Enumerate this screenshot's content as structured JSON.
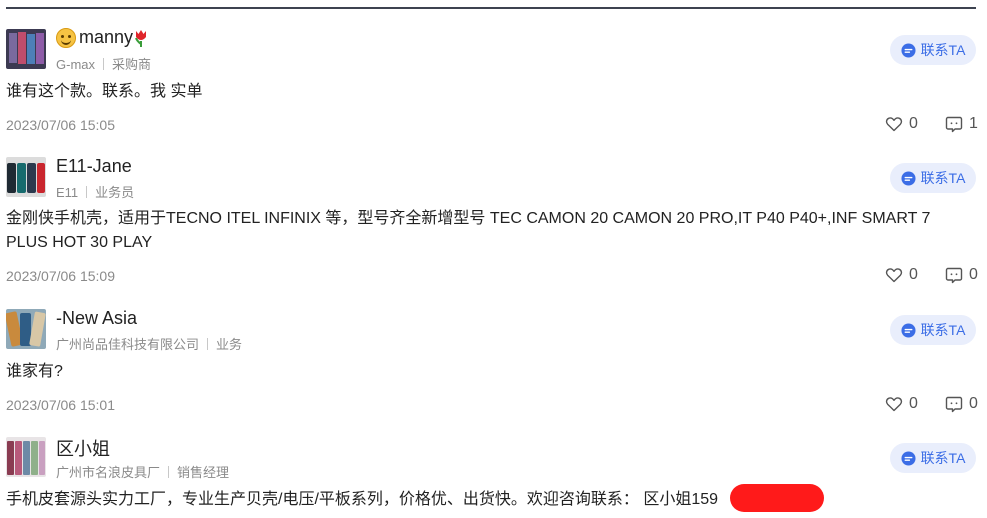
{
  "posts": [
    {
      "username": "manny",
      "company": "G-max",
      "role": "采购商",
      "contact_label": "联系TA",
      "content": "谁有这个款。联系。我 实单",
      "timestamp": "2023/07/06 15:05",
      "likes": "0",
      "comments": "1"
    },
    {
      "username": "E11-Jane",
      "company": "E11",
      "role": "业务员",
      "contact_label": "联系TA",
      "content": "金刚侠手机壳，适用于TECNO ITEL INFINIX 等，型号齐全新增型号 TEC CAMON 20 CAMON 20 PRO,IT P40 P40+,INF SMART 7 PLUS HOT 30 PLAY",
      "timestamp": "2023/07/06 15:09",
      "likes": "0",
      "comments": "0"
    },
    {
      "username": "-New Asia",
      "company": "广州尚品佳科技有限公司",
      "role": "业务",
      "contact_label": "联系TA",
      "content": "谁家有?",
      "timestamp": "2023/07/06 15:01",
      "likes": "0",
      "comments": "0"
    },
    {
      "username": "区小姐",
      "company": "广州市名浪皮具厂",
      "role": "销售经理",
      "contact_label": "联系TA",
      "content": "手机皮套源头实力工厂，专业生产贝壳/电压/平板系列，价格优、出货快。欢迎咨询联系： 区小姐159"
    }
  ],
  "icons": {
    "like": "heart-outline-icon",
    "comment": "comment-bubble-icon",
    "contact": "chat-bubble-icon"
  },
  "colors": {
    "accent": "#3b6de6",
    "button_bg": "#e9eefc",
    "muted_text": "#8a8a8a",
    "redaction": "#ff1a1a"
  }
}
